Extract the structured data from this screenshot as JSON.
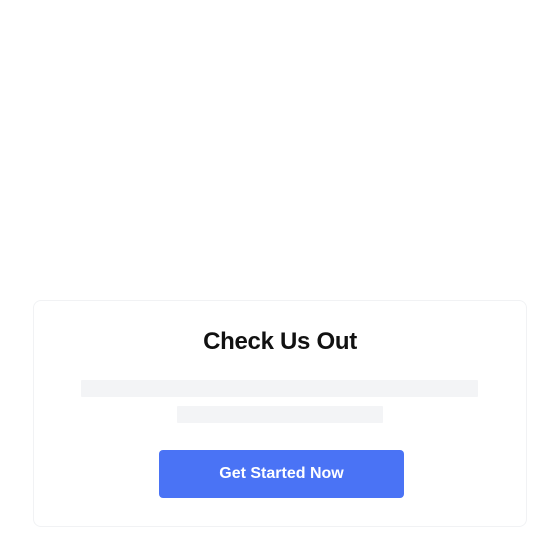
{
  "card": {
    "title": "Check Us Out",
    "cta_label": "Get Started Now",
    "placeholder_lines": 2
  },
  "colors": {
    "accent": "#4a73f5",
    "placeholder": "#f3f4f6",
    "card_border": "#f1f2f4",
    "title": "#111111"
  }
}
